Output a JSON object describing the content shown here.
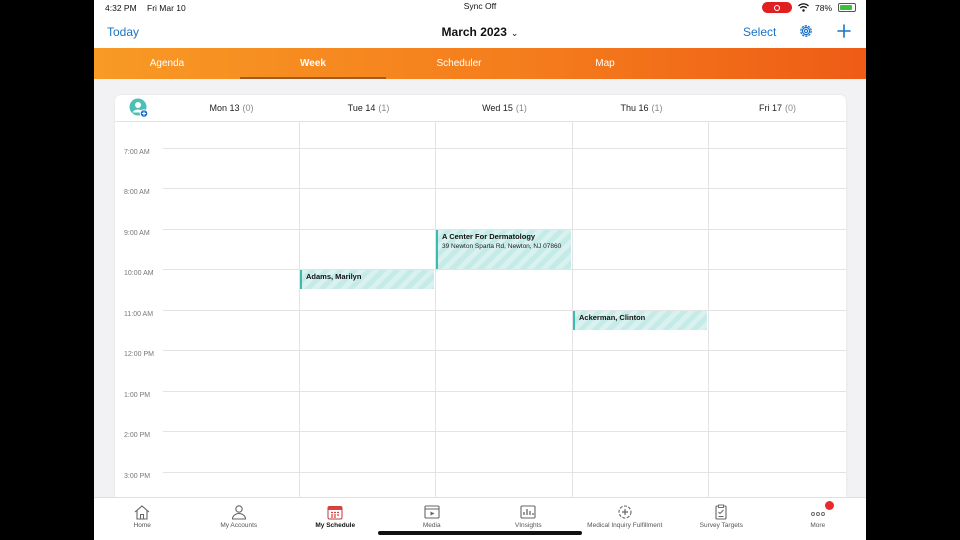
{
  "status_bar": {
    "time": "4:32 PM",
    "date": "Fri Mar 10",
    "sync": "Sync Off",
    "battery": "78%"
  },
  "nav": {
    "today": "Today",
    "month": "March 2023",
    "select": "Select"
  },
  "tabs": [
    {
      "label": "Agenda",
      "active": false
    },
    {
      "label": "Week",
      "active": true
    },
    {
      "label": "Scheduler",
      "active": false
    },
    {
      "label": "Map",
      "active": false
    }
  ],
  "days": [
    {
      "label": "Mon 13",
      "count": "(0)"
    },
    {
      "label": "Tue 14",
      "count": "(1)"
    },
    {
      "label": "Wed 15",
      "count": "(1)"
    },
    {
      "label": "Thu 16",
      "count": "(1)"
    },
    {
      "label": "Fri 17",
      "count": "(0)"
    }
  ],
  "times": [
    "7:00 AM",
    "8:00 AM",
    "9:00 AM",
    "10:00 AM",
    "11:00 AM",
    "12:00 PM",
    "1:00 PM",
    "2:00 PM",
    "3:00 PM"
  ],
  "events": [
    {
      "title": "A Center For Dermatology",
      "address": "39 Newton Sparta Rd, Newton, NJ 07860"
    },
    {
      "title": "Adams, Marilyn",
      "address": ""
    },
    {
      "title": "Ackerman, Clinton",
      "address": ""
    }
  ],
  "bottom_tabs": [
    {
      "label": "Home",
      "icon": "home-icon"
    },
    {
      "label": "My Accounts",
      "icon": "person-icon"
    },
    {
      "label": "My Schedule",
      "icon": "calendar-icon",
      "active": true
    },
    {
      "label": "Media",
      "icon": "media-icon"
    },
    {
      "label": "VInsights",
      "icon": "chart-icon"
    },
    {
      "label": "Medical Inquiry Fulfillment",
      "icon": "medical-icon"
    },
    {
      "label": "Survey Targets",
      "icon": "clipboard-icon"
    },
    {
      "label": "More",
      "icon": "more-icon"
    }
  ],
  "colors": {
    "accent": "#1a73c9",
    "tab_orange": "#f47a1b",
    "event": "#3dbab0",
    "badge": "#e82b2b"
  }
}
